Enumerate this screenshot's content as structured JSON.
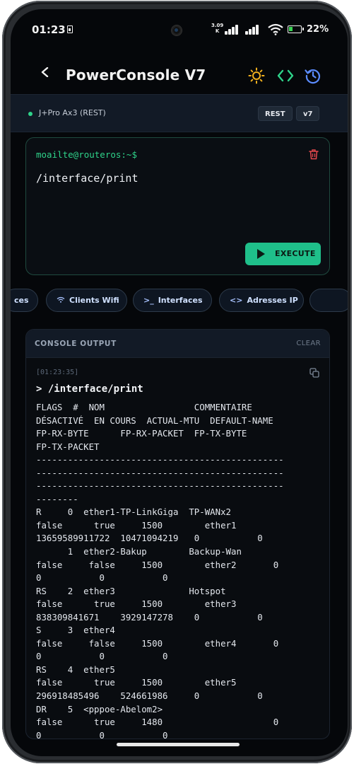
{
  "status_bar": {
    "time": "01:23",
    "speed_value": "3.09",
    "speed_unit": "K",
    "battery_percent": "22%",
    "battery_level": 0.22,
    "icons": [
      "sim-icon",
      "signal-icon",
      "signal-icon",
      "wifi-icon",
      "battery-icon"
    ]
  },
  "header": {
    "title": "PowerConsole V7",
    "buttons": [
      "back-icon",
      "theme-sun-icon",
      "code-icon",
      "history-icon"
    ],
    "accent_colors": {
      "sun": "#f2b01e",
      "code": "#2fd38a",
      "history": "#5b8cff"
    }
  },
  "device": {
    "name": "J+Pro Ax3 (REST)",
    "mode_label": "REST",
    "version_label": "v7",
    "status_color": "#2fd38a"
  },
  "command": {
    "prompt": "moailte@routeros:~$",
    "value": "/interface/print",
    "execute_label": "EXECUTE",
    "accent": "#1fbf8a"
  },
  "quick_commands": [
    {
      "label": "ces",
      "icon": ""
    },
    {
      "label": "Clients Wifi",
      "icon": "wifi-icon"
    },
    {
      "label": "Interfaces",
      "icon": "terminal-icon"
    },
    {
      "label": "Adresses IP",
      "icon": "code-icon"
    }
  ],
  "console": {
    "title": "CONSOLE OUTPUT",
    "clear_label": "CLEAR",
    "timestamp": "[01:23:35]",
    "echo": "> /interface/print",
    "lines": [
      "FLAGS  #  NOM                 COMMENTAIRE",
      "DÉSACTIVÉ  EN COURS  ACTUAL-MTU  DEFAULT-NAME",
      "FP-RX-BYTE      FP-RX-PACKET  FP-TX-BYTE",
      "FP-TX-PACKET",
      "-----------------------------------------------",
      "-----------------------------------------------",
      "-----------------------------------------------",
      "--------",
      "R     0  ether1-TP-LinkGiga  TP-WANx2",
      "false      true     1500        ether1",
      "13659589911722  10471094219   0           0",
      "      1  ether2-Bakup        Backup-Wan",
      "false     false     1500        ether2       0",
      "0           0           0",
      "RS    2  ether3              Hotspot",
      "false      true     1500        ether3",
      "838309841671    3929147278    0           0",
      "S     3  ether4",
      "false     false     1500        ether4       0",
      "0           0           0",
      "RS    4  ether5",
      "false      true     1500        ether5",
      "296918485496    524661986     0           0",
      "DR    5  <pppoe-Abelom2>",
      "false      true     1480                     0",
      "0           0           0"
    ]
  }
}
